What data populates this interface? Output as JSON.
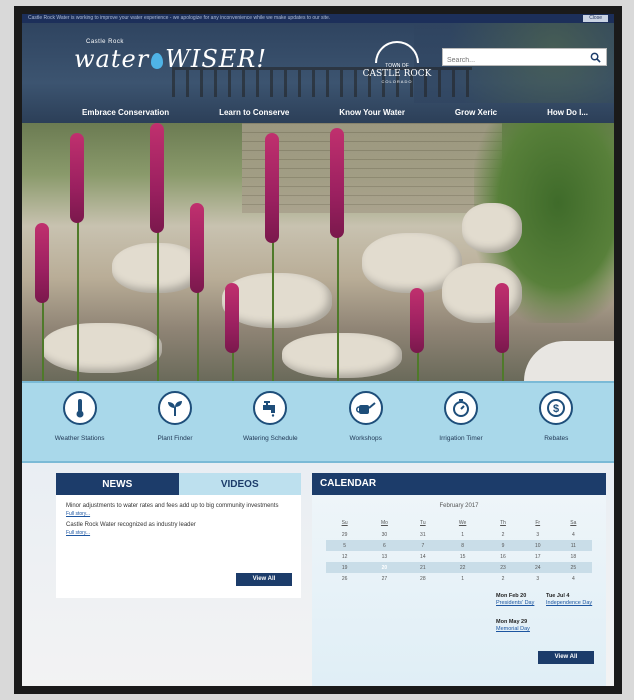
{
  "alert": {
    "text": "Castle Rock Water is working to improve your water experience - we apologize for any inconvenience while we make updates to our site.",
    "close_label": "Close"
  },
  "logo": {
    "small": "Castle Rock",
    "word1": "water",
    "word2": "WISER!"
  },
  "town_logo": {
    "line1": "TOWN OF",
    "line2": "CASTLE ROCK",
    "line3": "COLORADO"
  },
  "search": {
    "placeholder": "Search..."
  },
  "nav": [
    "Embrace Conservation",
    "Learn to Conserve",
    "Know Your Water",
    "Grow Xeric",
    "How Do I..."
  ],
  "quick_links": [
    {
      "label": "Weather Stations",
      "icon": "thermometer-icon"
    },
    {
      "label": "Plant Finder",
      "icon": "plant-icon"
    },
    {
      "label": "Watering Schedule",
      "icon": "faucet-icon"
    },
    {
      "label": "Workshops",
      "icon": "watering-can-icon"
    },
    {
      "label": "Irrigation Timer",
      "icon": "stopwatch-icon"
    },
    {
      "label": "Rebates",
      "icon": "dollar-icon"
    }
  ],
  "news": {
    "tab_news": "NEWS",
    "tab_videos": "VIDEOS",
    "items": [
      {
        "title": "Minor adjustments to water rates and fees add up to big community investments",
        "more": "Full story..."
      },
      {
        "title": "Castle Rock Water recognized as industry leader",
        "more": "Full story..."
      }
    ],
    "view_all": "View All"
  },
  "calendar": {
    "title": "CALENDAR",
    "month": "February 2017",
    "weekdays": [
      "Su",
      "Mo",
      "Tu",
      "We",
      "Th",
      "Fr",
      "Sa"
    ],
    "weeks": [
      [
        "29",
        "30",
        "31",
        "1",
        "2",
        "3",
        "4"
      ],
      [
        "5",
        "6",
        "7",
        "8",
        "9",
        "10",
        "11"
      ],
      [
        "12",
        "13",
        "14",
        "15",
        "16",
        "17",
        "18"
      ],
      [
        "19",
        "20",
        "21",
        "22",
        "23",
        "24",
        "25"
      ],
      [
        "26",
        "27",
        "28",
        "1",
        "2",
        "3",
        "4"
      ]
    ],
    "today": "20",
    "events": [
      {
        "date": "Mon Feb 20",
        "name": "Presidents' Day"
      },
      {
        "date": "Tue Jul 4",
        "name": "Independence Day"
      },
      {
        "date": "Mon May 29",
        "name": "Memorial Day"
      }
    ],
    "view_all": "View All"
  },
  "colors": {
    "navy": "#1c3c6a",
    "light_blue": "#a9d8ea",
    "magenta": "#b02a6c"
  }
}
